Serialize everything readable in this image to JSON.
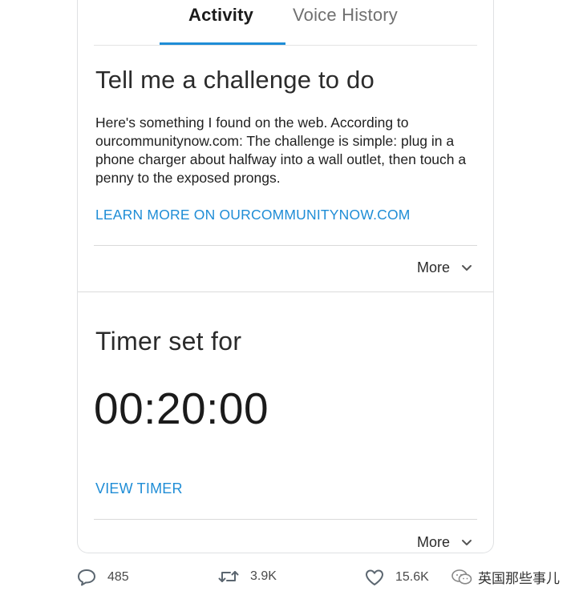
{
  "tabs": [
    {
      "label": "Activity",
      "active": true
    },
    {
      "label": "Voice History",
      "active": false
    }
  ],
  "cards": [
    {
      "title": "Tell me a challenge to do",
      "body": "Here's something I found on the web. According to ourcommunitynow.com: The challenge is simple: plug in a phone charger about halfway into a wall outlet, then touch a penny to the exposed prongs.",
      "link": "LEARN MORE ON OURCOMMUNITYNOW.COM",
      "more_label": "More"
    },
    {
      "title": "Timer set for",
      "timer": "00:20:00",
      "link": "VIEW TIMER",
      "more_label": "More"
    }
  ],
  "stats": {
    "replies": "485",
    "retweets": "3.9K",
    "likes": "15.6K"
  },
  "watermark": {
    "text": "英国那些事儿",
    "icon": "wechat-icon"
  },
  "colors": {
    "accent": "#1f8dd6",
    "text": "#1f1f1f",
    "muted": "#707070"
  }
}
